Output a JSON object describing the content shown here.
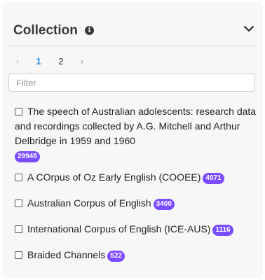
{
  "panel": {
    "title": "Collection",
    "info_icon": "info-icon",
    "toggle_icon": "chevron-down-icon"
  },
  "pager": {
    "prev": "‹",
    "pages": [
      "1",
      "2"
    ],
    "active_page": "1",
    "next": "›"
  },
  "filter": {
    "placeholder": "Filter",
    "value": ""
  },
  "items": [
    {
      "label": "The speech of Australian adolescents: research data and recordings collected by A.G. Mitchell and Arthur Delbridge in 1959 and 1960",
      "count": "29948",
      "checked": false
    },
    {
      "label": "A COrpus of Oz Early English (COOEE)",
      "count": "4071",
      "checked": false
    },
    {
      "label": "Australian Corpus of English",
      "count": "3400",
      "checked": false
    },
    {
      "label": "International Corpus of English (ICE-AUS)",
      "count": "1116",
      "checked": false
    },
    {
      "label": "Braided Channels",
      "count": "522",
      "checked": false
    }
  ],
  "colors": {
    "badge": "#7c4dff",
    "active_page": "#1e88e5",
    "panel_background": "#f7f7f7"
  }
}
